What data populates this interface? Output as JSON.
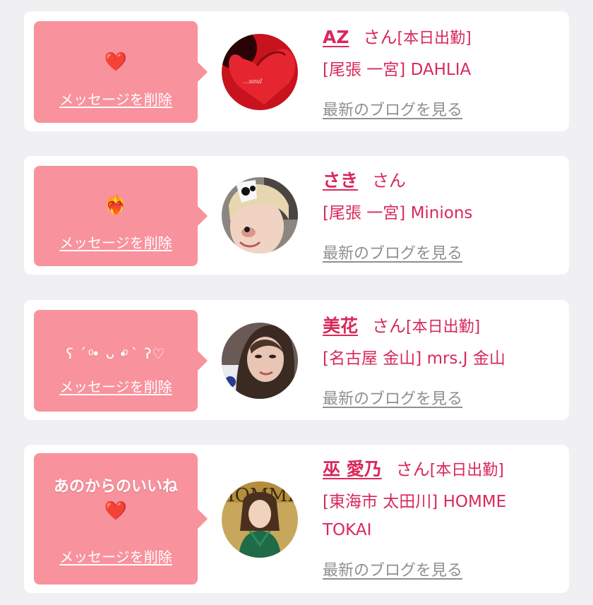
{
  "suffix_san": "さん",
  "delete_label": "メッセージを削除",
  "blog_label": "最新のブログを見る",
  "messages": [
    {
      "name": "AZ",
      "work_status": "[本日出勤]",
      "shop": "[尾張 一宮] DAHLIA",
      "message": "❤️",
      "message_icon": "red-heart-icon"
    },
    {
      "name": "さき",
      "work_status": "",
      "shop": "[尾張 一宮] Minions",
      "message": "❤️‍🔥",
      "message_icon": "heart-on-fire-icon"
    },
    {
      "name": "美花",
      "work_status": "[本日出勤]",
      "shop": "[名古屋 金山] mrs.J 金山",
      "message": "ʕ ´ ͦ• ᴗ •ͦ ` ʔ♡"
    },
    {
      "name": "巫 愛乃",
      "work_status": "[本日出勤]",
      "shop": "[東海市 太田川] HOMME TOKAI",
      "shop_line1": "[東海市 太田川] HOMME",
      "shop_line2": "TOKAI",
      "message": "あのからのいいね",
      "message_line2": "❤️",
      "message_icon": "red-heart-icon"
    }
  ],
  "colors": {
    "background": "#f0f0f2",
    "card": "#ffffff",
    "bubble": "#f8929d",
    "accent": "#d8295a",
    "link_gray": "#8f8f8f"
  }
}
